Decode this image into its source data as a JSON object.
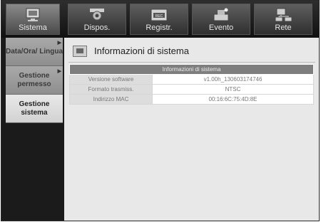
{
  "tabs": [
    {
      "label": "Sistema",
      "icon": "monitor-icon",
      "active": true
    },
    {
      "label": "Dispos.",
      "icon": "camera-icon",
      "active": false
    },
    {
      "label": "Registr.",
      "icon": "rec-icon",
      "active": false
    },
    {
      "label": "Evento",
      "icon": "alarm-icon",
      "active": false
    },
    {
      "label": "Rete",
      "icon": "network-icon",
      "active": false
    }
  ],
  "sidebar": {
    "items": [
      {
        "label": "Data/Ora/ Lingua",
        "active": false
      },
      {
        "label": "Gestione permesso",
        "active": false
      },
      {
        "label": "Gestione sistema",
        "active": true
      }
    ]
  },
  "panel": {
    "title": "Informazioni di sistema",
    "table_header": "Informazioni di sistema",
    "rows": [
      {
        "key": "Versione software",
        "value": "v1.00h_130603174746"
      },
      {
        "key": "Formato trasmiss.",
        "value": "NTSC"
      },
      {
        "key": "Indirizzo MAC",
        "value": "00:16:6C:75:4D:8E"
      }
    ]
  },
  "colors": {
    "active_tab": "#8a8a8a",
    "table_header_bg": "#7e7e7e",
    "panel_bg": "#e8e8e8"
  }
}
